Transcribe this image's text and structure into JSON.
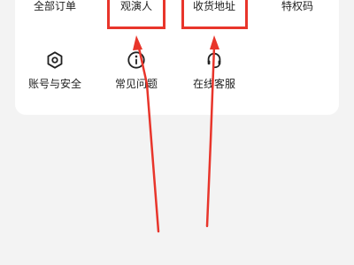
{
  "menu": {
    "row1": [
      {
        "label": "全部订单"
      },
      {
        "label": "观演人"
      },
      {
        "label": "收货地址"
      },
      {
        "label": "特权码"
      }
    ],
    "row2": [
      {
        "label": "账号与安全",
        "icon": "hexagon-settings-icon"
      },
      {
        "label": "常见问题",
        "icon": "info-icon"
      },
      {
        "label": "在线客服",
        "icon": "headset-icon"
      }
    ]
  },
  "annotation": {
    "color": "#e8352b"
  }
}
